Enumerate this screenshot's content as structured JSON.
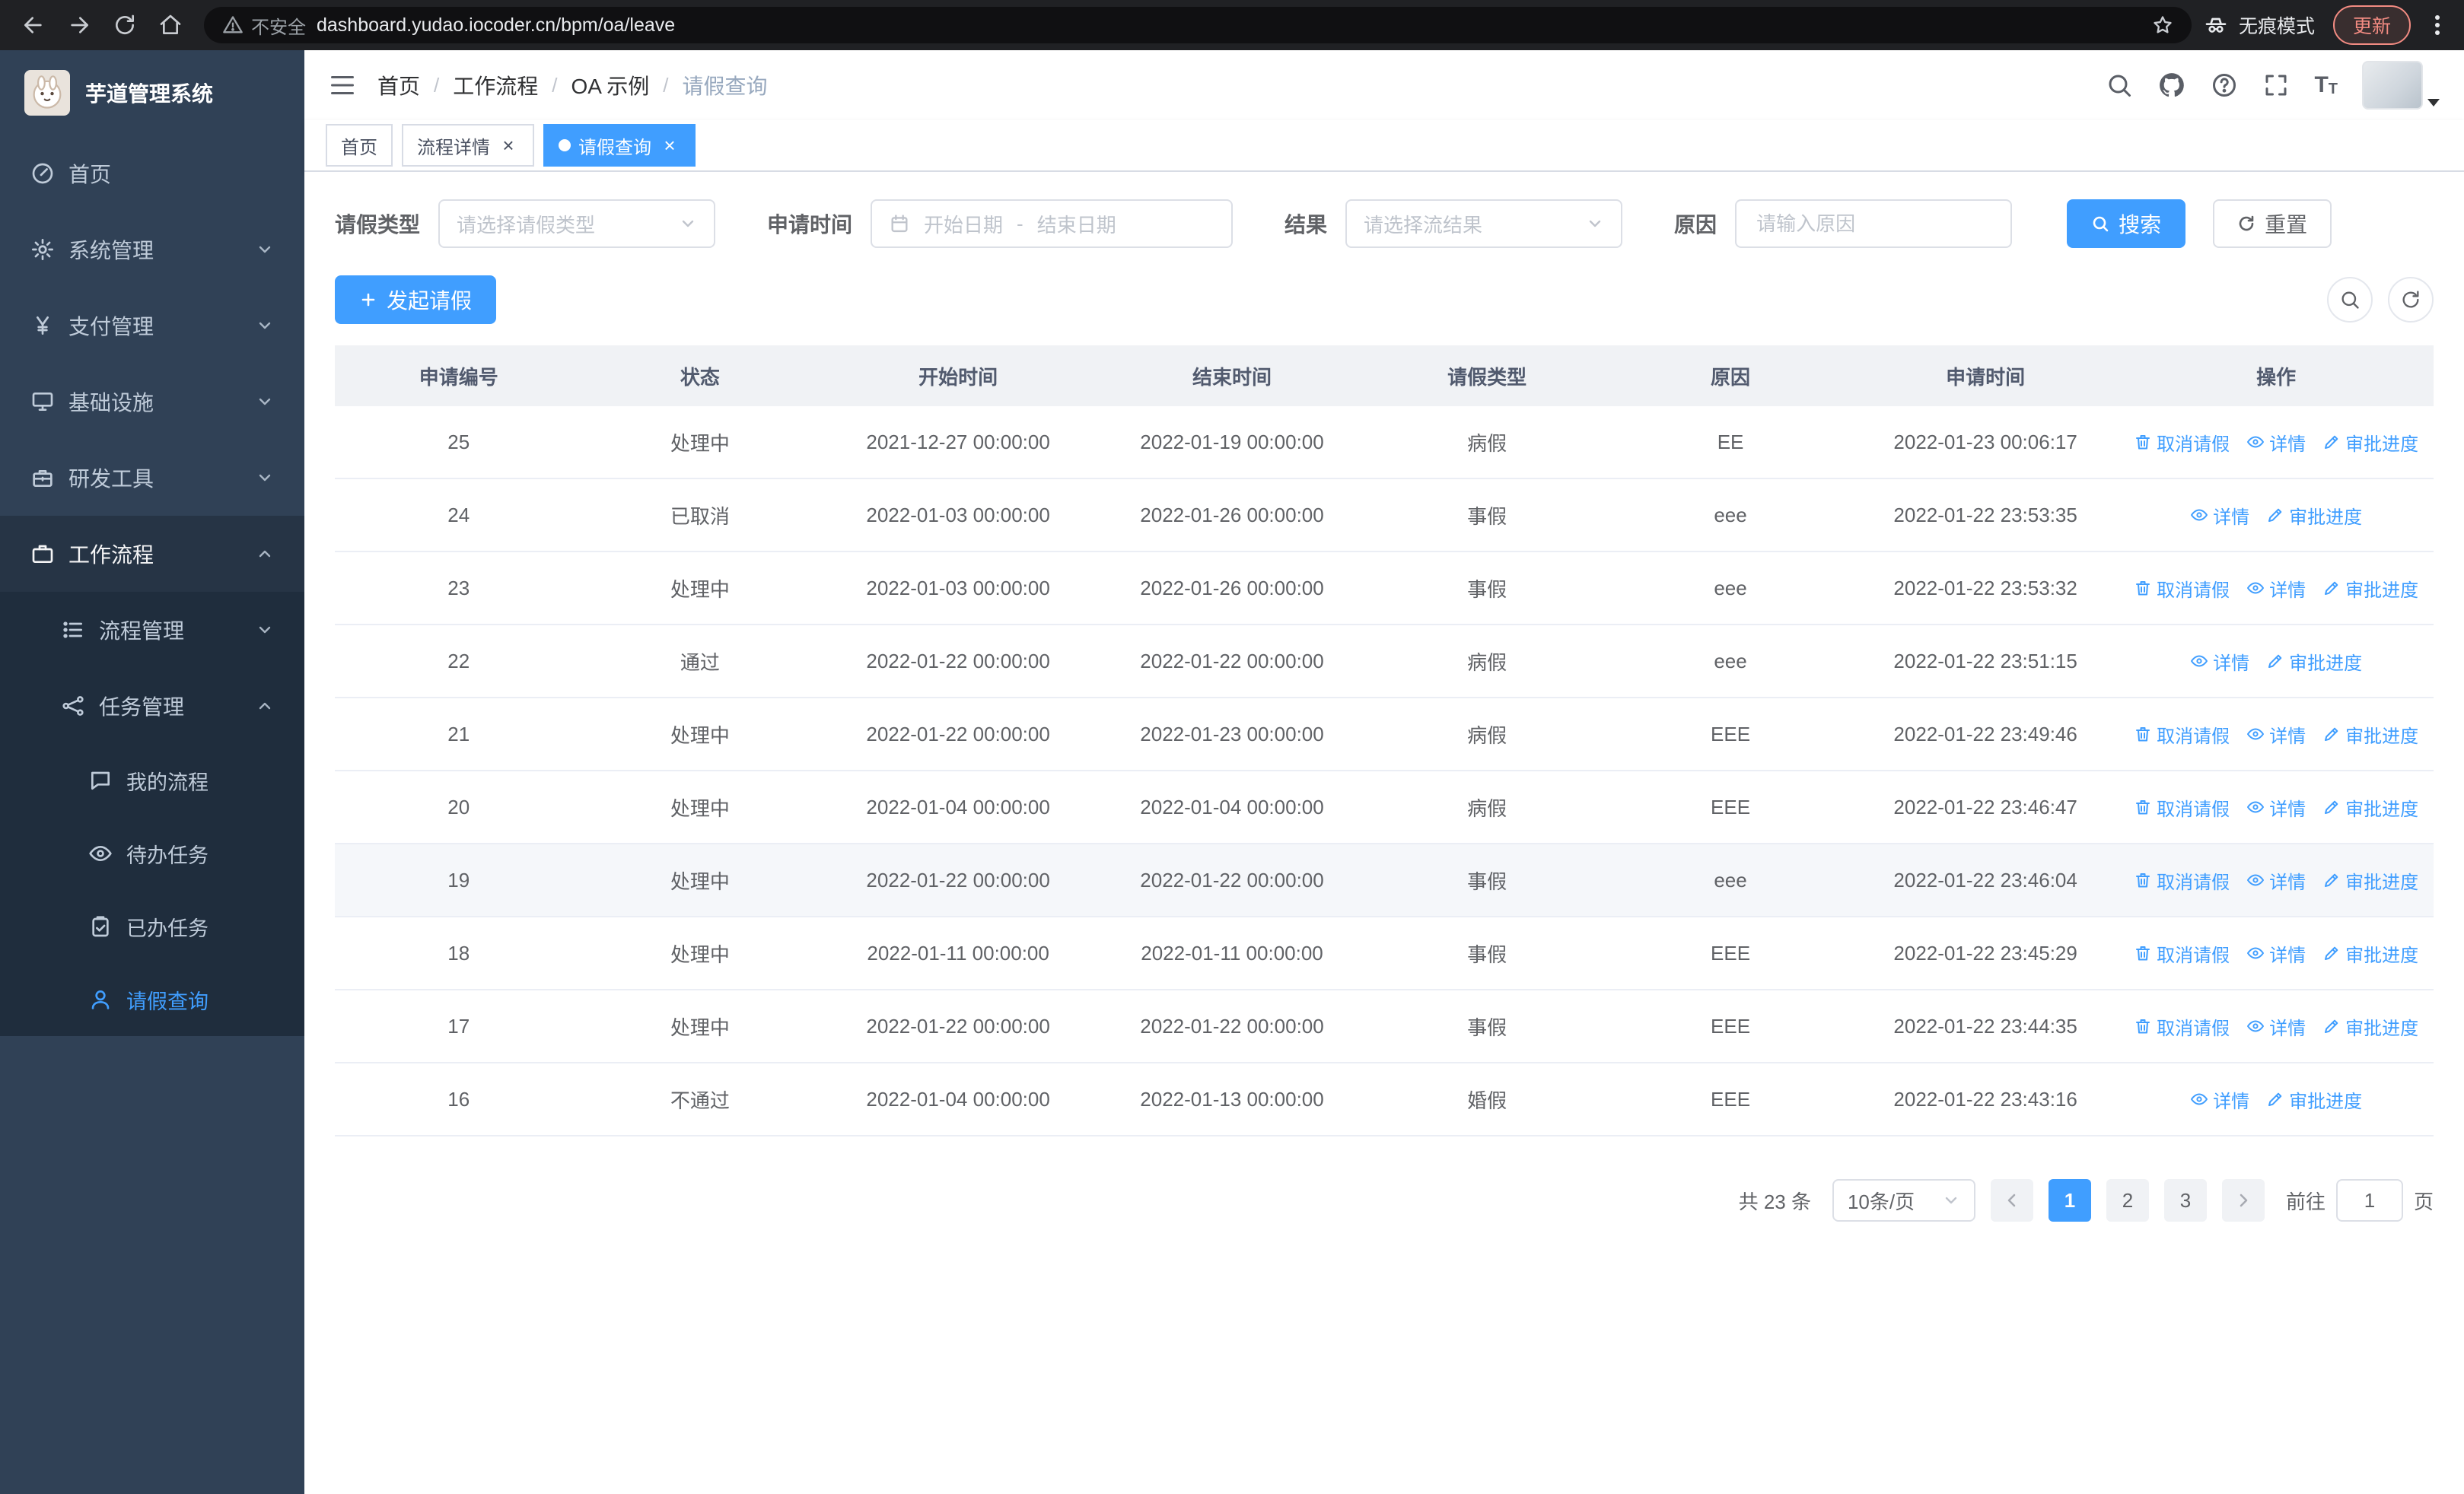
{
  "browser": {
    "security_label": "不安全",
    "url": "dashboard.yudao.iocoder.cn/bpm/oa/leave",
    "incognito_label": "无痕模式",
    "update_label": "更新"
  },
  "sidebar": {
    "logo_title": "芋道管理系统",
    "items": [
      {
        "label": "首页"
      },
      {
        "label": "系统管理"
      },
      {
        "label": "支付管理"
      },
      {
        "label": "基础设施"
      },
      {
        "label": "研发工具"
      },
      {
        "label": "工作流程"
      }
    ],
    "workflow_children": [
      {
        "label": "流程管理"
      },
      {
        "label": "任务管理"
      }
    ],
    "task_children": [
      {
        "label": "我的流程"
      },
      {
        "label": "待办任务"
      },
      {
        "label": "已办任务"
      },
      {
        "label": "请假查询"
      }
    ]
  },
  "header": {
    "breadcrumb": [
      "首页",
      "工作流程",
      "OA 示例",
      "请假查询"
    ]
  },
  "tabs": [
    {
      "label": "首页"
    },
    {
      "label": "流程详情"
    },
    {
      "label": "请假查询"
    }
  ],
  "filters": {
    "leave_type_label": "请假类型",
    "leave_type_placeholder": "请选择请假类型",
    "apply_time_label": "申请时间",
    "start_date_placeholder": "开始日期",
    "range_separator": "-",
    "end_date_placeholder": "结束日期",
    "result_label": "结果",
    "result_placeholder": "请选择流结果",
    "reason_label": "原因",
    "reason_placeholder": "请输入原因",
    "search_label": "搜索",
    "reset_label": "重置"
  },
  "toolbar": {
    "create_label": "发起请假"
  },
  "table": {
    "columns": [
      "申请编号",
      "状态",
      "开始时间",
      "结束时间",
      "请假类型",
      "原因",
      "申请时间",
      "操作"
    ],
    "actions": {
      "cancel": "取消请假",
      "detail": "详情",
      "progress": "审批进度"
    },
    "rows": [
      {
        "id": "25",
        "status": "处理中",
        "start": "2021-12-27 00:00:00",
        "end": "2022-01-19 00:00:00",
        "type": "病假",
        "reason": "EE",
        "applied": "2022-01-23 00:06:17",
        "cancellable": true,
        "hovered": false
      },
      {
        "id": "24",
        "status": "已取消",
        "start": "2022-01-03 00:00:00",
        "end": "2022-01-26 00:00:00",
        "type": "事假",
        "reason": "eee",
        "applied": "2022-01-22 23:53:35",
        "cancellable": false,
        "hovered": false
      },
      {
        "id": "23",
        "status": "处理中",
        "start": "2022-01-03 00:00:00",
        "end": "2022-01-26 00:00:00",
        "type": "事假",
        "reason": "eee",
        "applied": "2022-01-22 23:53:32",
        "cancellable": true,
        "hovered": false
      },
      {
        "id": "22",
        "status": "通过",
        "start": "2022-01-22 00:00:00",
        "end": "2022-01-22 00:00:00",
        "type": "病假",
        "reason": "eee",
        "applied": "2022-01-22 23:51:15",
        "cancellable": false,
        "hovered": false
      },
      {
        "id": "21",
        "status": "处理中",
        "start": "2022-01-22 00:00:00",
        "end": "2022-01-23 00:00:00",
        "type": "病假",
        "reason": "EEE",
        "applied": "2022-01-22 23:49:46",
        "cancellable": true,
        "hovered": false
      },
      {
        "id": "20",
        "status": "处理中",
        "start": "2022-01-04 00:00:00",
        "end": "2022-01-04 00:00:00",
        "type": "病假",
        "reason": "EEE",
        "applied": "2022-01-22 23:46:47",
        "cancellable": true,
        "hovered": false
      },
      {
        "id": "19",
        "status": "处理中",
        "start": "2022-01-22 00:00:00",
        "end": "2022-01-22 00:00:00",
        "type": "事假",
        "reason": "eee",
        "applied": "2022-01-22 23:46:04",
        "cancellable": true,
        "hovered": true
      },
      {
        "id": "18",
        "status": "处理中",
        "start": "2022-01-11 00:00:00",
        "end": "2022-01-11 00:00:00",
        "type": "事假",
        "reason": "EEE",
        "applied": "2022-01-22 23:45:29",
        "cancellable": true,
        "hovered": false
      },
      {
        "id": "17",
        "status": "处理中",
        "start": "2022-01-22 00:00:00",
        "end": "2022-01-22 00:00:00",
        "type": "事假",
        "reason": "EEE",
        "applied": "2022-01-22 23:44:35",
        "cancellable": true,
        "hovered": false
      },
      {
        "id": "16",
        "status": "不通过",
        "start": "2022-01-04 00:00:00",
        "end": "2022-01-13 00:00:00",
        "type": "婚假",
        "reason": "EEE",
        "applied": "2022-01-22 23:43:16",
        "cancellable": false,
        "hovered": false
      }
    ]
  },
  "pagination": {
    "total": "共 23 条",
    "page_size": "10条/页",
    "pages": [
      "1",
      "2",
      "3"
    ],
    "active_page": "1",
    "goto_label": "前往",
    "goto_value": "1",
    "page_suffix": "页"
  },
  "colors": {
    "primary": "#409eff",
    "sidebar_bg": "#304156",
    "submenu_bg": "#1f2d3d",
    "chrome_bg": "#202124",
    "danger_chip": "#f28b82"
  }
}
